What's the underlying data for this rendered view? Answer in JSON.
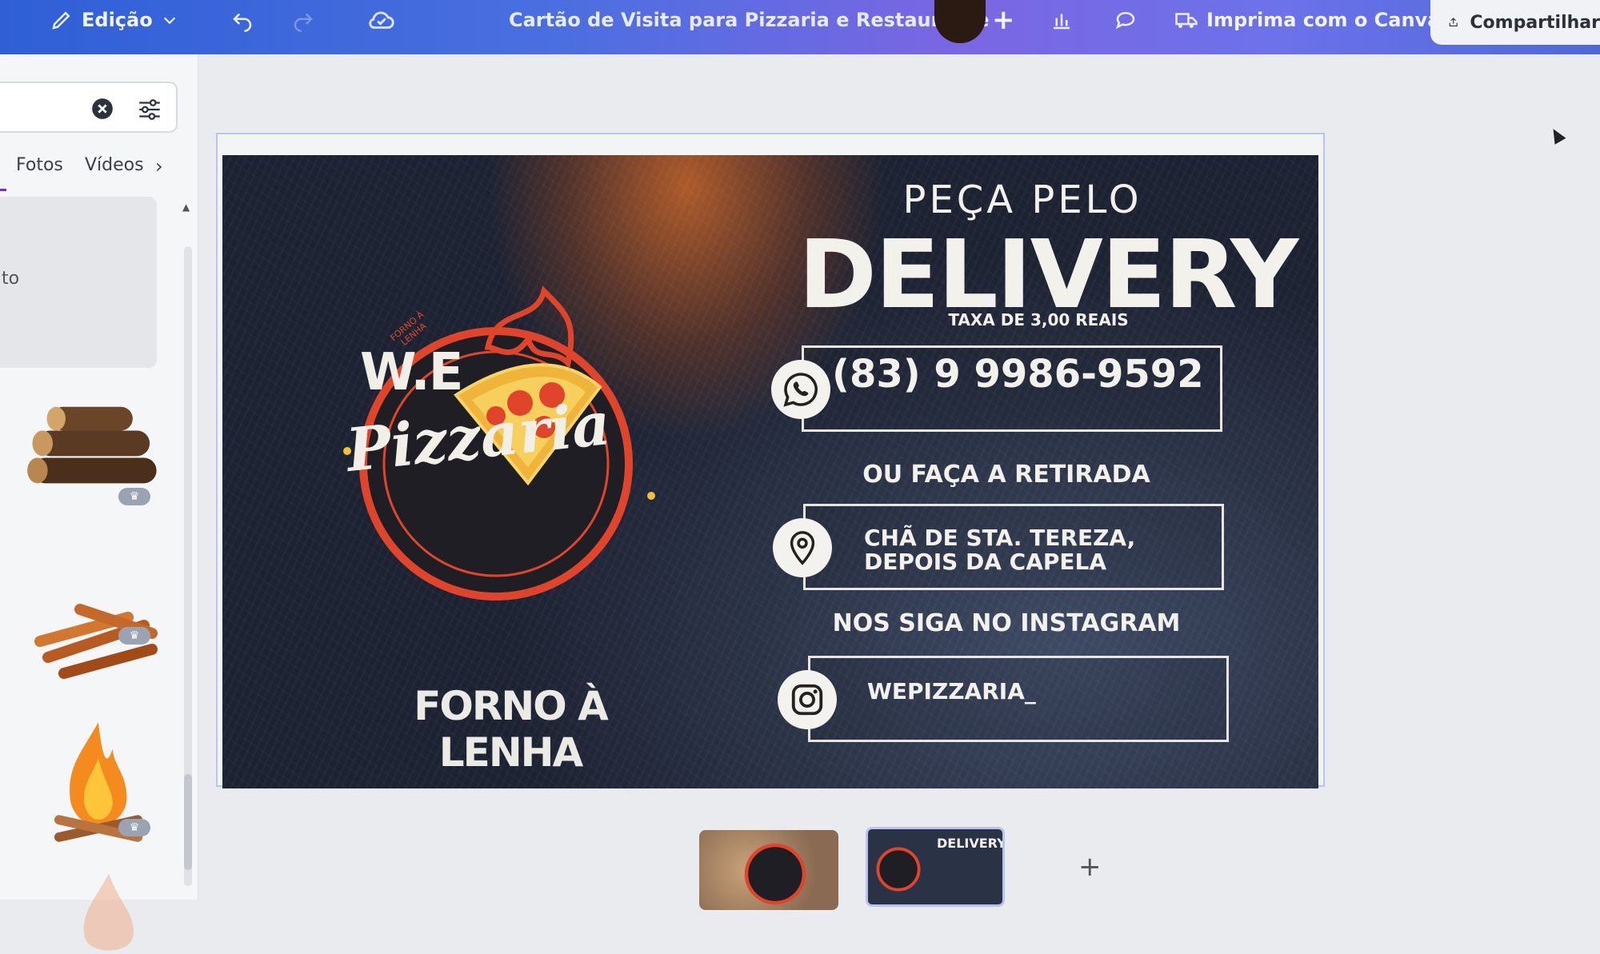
{
  "topbar": {
    "edit_label": "Edição",
    "doc_title": "Cartão de Visita para Pizzaria e Restaurante",
    "print_label": "Imprima com o Canva",
    "share_label": "Compartilhar"
  },
  "left_panel": {
    "tabs": [
      "Fotos",
      "Vídeos"
    ],
    "preview_text_fragment": "to"
  },
  "card": {
    "headline_small": "PEÇA PELO",
    "headline_big": "DELIVERY",
    "fee": "TAXA DE 3,00 REAIS",
    "phone": "(83) 9 9986-9592",
    "pickup": "OU FAÇA A RETIRADA",
    "address_line1": "CHÃ DE STA. TEREZA,",
    "address_line2": "DEPOIS DA CAPELA",
    "follow": "NOS SIGA NO INSTAGRAM",
    "instagram_handle": "WEPIZZARIA_",
    "logo_top": "W.E",
    "logo_script": "Pizzaria",
    "logo_arc": "FORNO À LENHA",
    "tagline": "FORNO À LENHA"
  },
  "pages": {
    "thumb2_title": "DELIVERY"
  },
  "colors": {
    "topbar_start": "#2f5fd6",
    "topbar_end": "#7b66e3",
    "logo_red": "#e0452b",
    "card_dark": "#262c3c"
  }
}
